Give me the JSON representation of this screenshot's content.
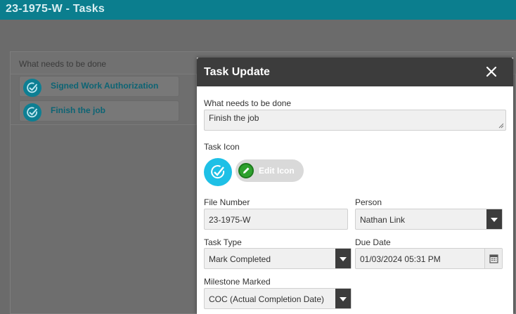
{
  "app": {
    "title": "23-1975-W - Tasks"
  },
  "grid": {
    "column_header": "What needs to be done",
    "tasks": [
      {
        "label": "Signed Work Authorization",
        "icon": "check-circle-icon"
      },
      {
        "label": "Finish the job",
        "icon": "check-circle-icon"
      }
    ]
  },
  "modal": {
    "title": "Task Update",
    "close_icon": "close-icon",
    "what_label": "What needs to be done",
    "what_value": "Finish the job",
    "task_icon_label": "Task Icon",
    "task_icon": "check-circle-icon",
    "edit_icon_label": "Edit Icon",
    "file_number_label": "File Number",
    "file_number_value": "23-1975-W",
    "person_label": "Person",
    "person_value": "Nathan Link",
    "task_type_label": "Task Type",
    "task_type_value": "Mark Completed",
    "due_date_label": "Due Date",
    "due_date_value": "01/03/2024 05:31 PM",
    "milestone_label": "Milestone Marked",
    "milestone_value": "COC (Actual Completion Date)"
  },
  "colors": {
    "appbar": "#0b7e8e",
    "accent": "#1ec0e6",
    "modal_header": "#3c3c3c",
    "edit_green": "#2ea12e"
  }
}
